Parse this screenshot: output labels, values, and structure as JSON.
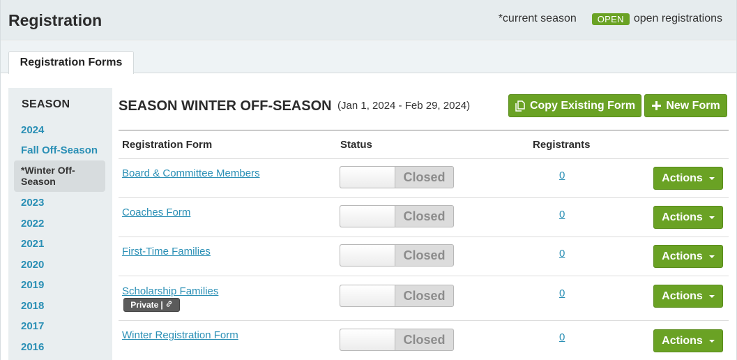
{
  "header": {
    "title": "Registration",
    "current_season_note": "*current season",
    "open_badge": "OPEN",
    "open_note": "open registrations"
  },
  "tabs": [
    {
      "label": "Registration Forms"
    }
  ],
  "sidebar": {
    "heading": "SEASON",
    "items": [
      {
        "label": "2024"
      },
      {
        "label": "Fall Off-Season"
      },
      {
        "label": "*Winter Off-Season",
        "active": true
      },
      {
        "label": "2023"
      },
      {
        "label": "2022"
      },
      {
        "label": "2021"
      },
      {
        "label": "2020"
      },
      {
        "label": "2019"
      },
      {
        "label": "2018"
      },
      {
        "label": "2017"
      },
      {
        "label": "2016"
      }
    ]
  },
  "main": {
    "season_title": "SEASON WINTER OFF-SEASON",
    "season_range": "(Jan 1, 2024 - Feb 29, 2024)",
    "copy_button": "Copy Existing Form",
    "new_button": "New Form",
    "columns": [
      "Registration Form",
      "Status",
      "Registrants"
    ],
    "rows": [
      {
        "form": "Board & Committee Members",
        "status": "Closed",
        "registrants": "0",
        "actions": "Actions"
      },
      {
        "form": "Coaches Form",
        "status": "Closed",
        "registrants": "0",
        "actions": "Actions"
      },
      {
        "form": "First-Time Families",
        "status": "Closed",
        "registrants": "0",
        "actions": "Actions"
      },
      {
        "form": "Scholarship Families",
        "status": "Closed",
        "registrants": "0",
        "actions": "Actions",
        "badge": "Private"
      },
      {
        "form": "Winter Registration Form",
        "status": "Closed",
        "registrants": "0",
        "actions": "Actions"
      }
    ]
  },
  "colors": {
    "accent_green": "#6aa224",
    "link_blue": "#2a8fb5",
    "header_bg": "#e6ecee",
    "sidebar_bg": "#e9eef0"
  }
}
